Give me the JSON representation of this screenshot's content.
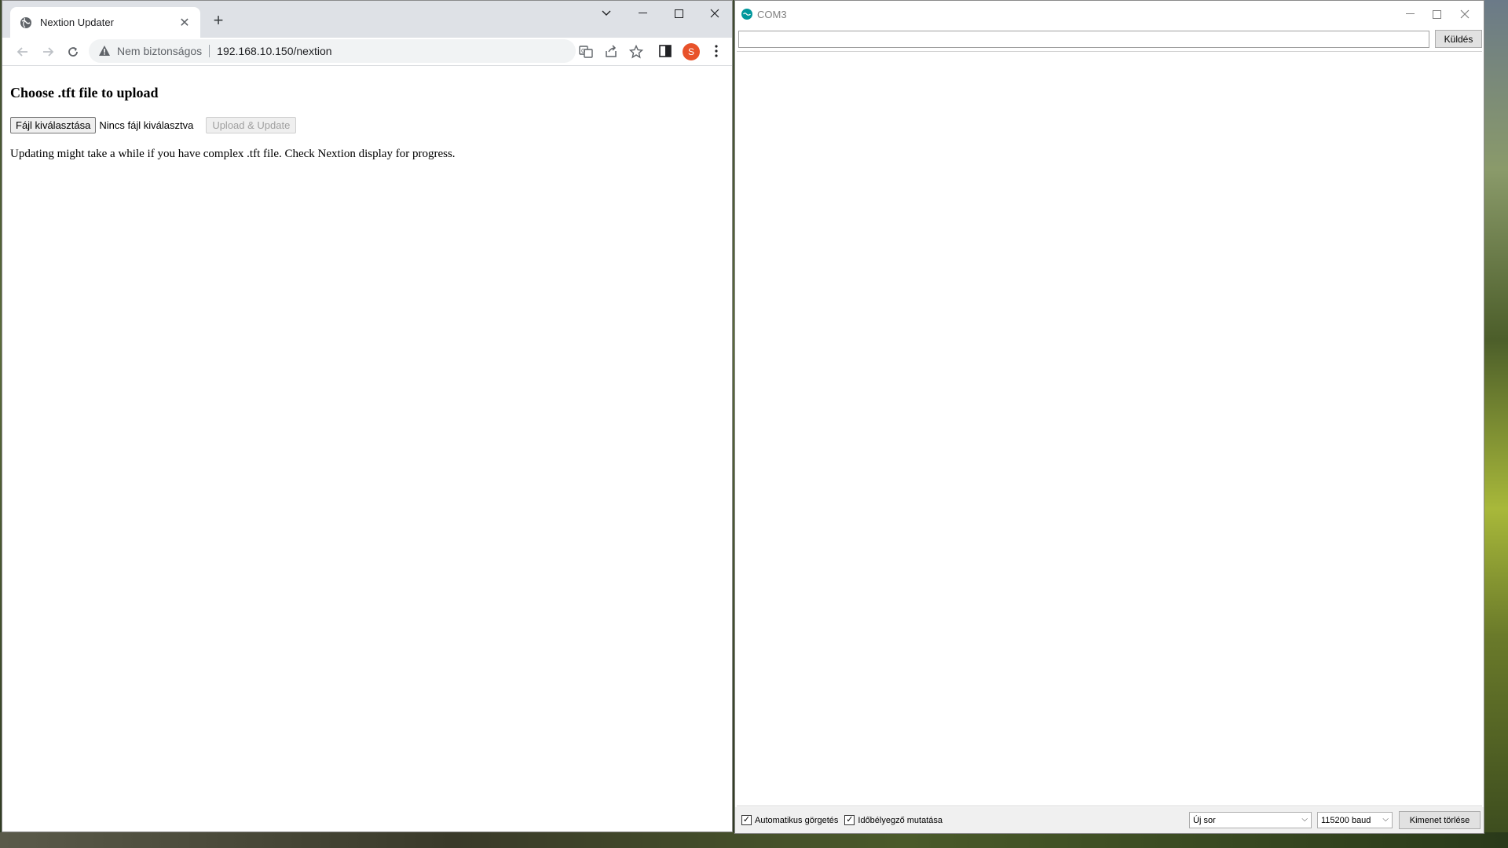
{
  "browser": {
    "tab_title": "Nextion Updater",
    "address": {
      "security_label": "Nem biztonságos",
      "url": "192.168.10.150/nextion"
    },
    "avatar_initial": "S"
  },
  "page": {
    "heading": "Choose .tft file to upload",
    "file_button": "Fájl kiválasztása",
    "file_status": "Nincs fájl kiválasztva",
    "upload_button": "Upload & Update",
    "note": "Updating might take a while if you have complex .tft file. Check Nextion display for progress."
  },
  "serial_monitor": {
    "title": "COM3",
    "send_button": "Küldés",
    "input_value": "",
    "autoscroll_label": "Automatikus görgetés",
    "autoscroll_checked": true,
    "timestamp_label": "Időbélyegző mutatása",
    "timestamp_checked": true,
    "line_ending": "Új sor",
    "baud": "115200 baud",
    "clear_button": "Kimenet törlése"
  },
  "colors": {
    "avatar": "#e8522a",
    "arduino_teal": "#00979c"
  }
}
